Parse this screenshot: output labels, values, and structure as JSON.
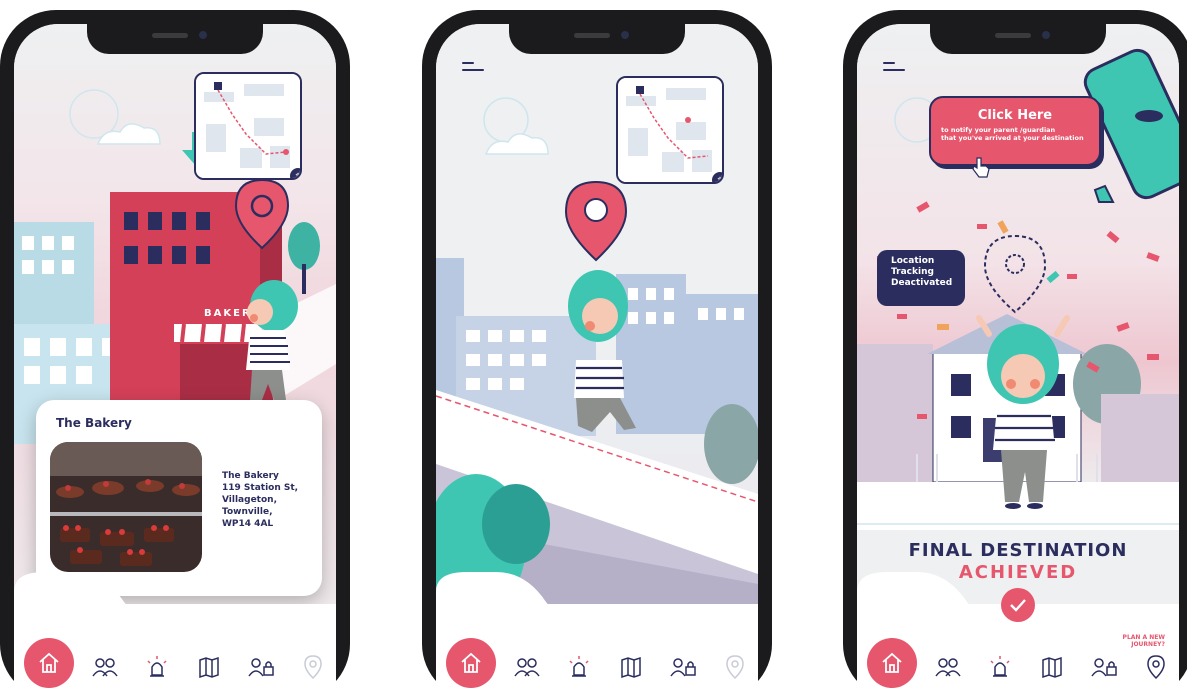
{
  "colors": {
    "navy": "#2b2d5e",
    "pink": "#e6566d",
    "teal": "#3fc6b3",
    "sky": "#eef0f1"
  },
  "phones": [
    {
      "screen": "bakery-location",
      "card": {
        "title": "The Bakery",
        "address_lines": [
          "The Bakery",
          "119 Station St,",
          "Villageton,",
          "Townville,",
          "WP14 4AL"
        ]
      },
      "building_sign": "BAKER"
    },
    {
      "screen": "walking"
    },
    {
      "screen": "final-destination",
      "notify": {
        "title": "Click Here",
        "lines": [
          "to notify your parent /guardian",
          "that you've arrived at your destination"
        ]
      },
      "tracking_lines": [
        "Location",
        "Tracking",
        "Deactivated"
      ],
      "final_line1": "FINAL DESTINATION",
      "final_line2": "ACHIEVED",
      "plan_lines": [
        "PLAN A NEW",
        "JOURNEY?"
      ]
    }
  ],
  "nav_icons": [
    "home-icon",
    "friends-icon",
    "alert-icon",
    "map-icon",
    "contacts-lock-icon",
    "location-pin-icon"
  ]
}
